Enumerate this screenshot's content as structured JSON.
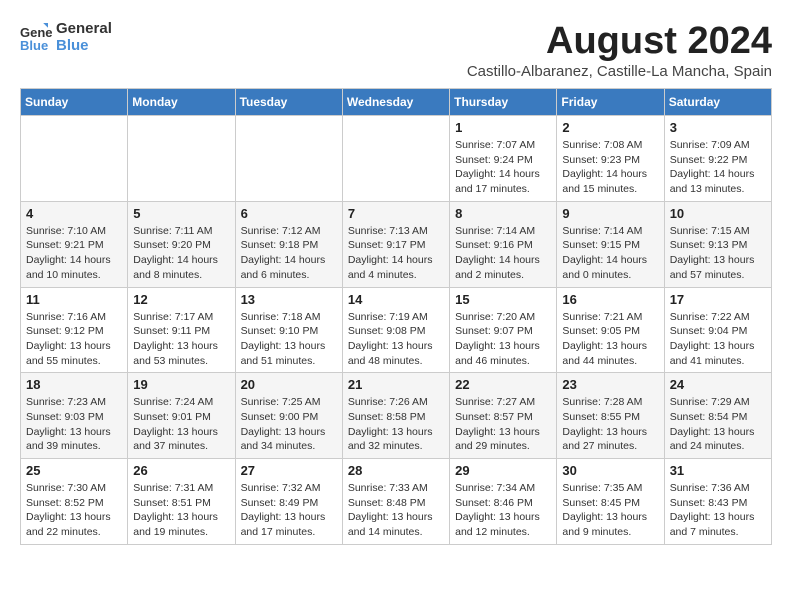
{
  "logo": {
    "line1": "General",
    "line2": "Blue"
  },
  "title": "August 2024",
  "location": "Castillo-Albaranez, Castille-La Mancha, Spain",
  "days_header": [
    "Sunday",
    "Monday",
    "Tuesday",
    "Wednesday",
    "Thursday",
    "Friday",
    "Saturday"
  ],
  "weeks": [
    [
      {
        "day": "",
        "info": ""
      },
      {
        "day": "",
        "info": ""
      },
      {
        "day": "",
        "info": ""
      },
      {
        "day": "",
        "info": ""
      },
      {
        "day": "1",
        "info": "Sunrise: 7:07 AM\nSunset: 9:24 PM\nDaylight: 14 hours\nand 17 minutes."
      },
      {
        "day": "2",
        "info": "Sunrise: 7:08 AM\nSunset: 9:23 PM\nDaylight: 14 hours\nand 15 minutes."
      },
      {
        "day": "3",
        "info": "Sunrise: 7:09 AM\nSunset: 9:22 PM\nDaylight: 14 hours\nand 13 minutes."
      }
    ],
    [
      {
        "day": "4",
        "info": "Sunrise: 7:10 AM\nSunset: 9:21 PM\nDaylight: 14 hours\nand 10 minutes."
      },
      {
        "day": "5",
        "info": "Sunrise: 7:11 AM\nSunset: 9:20 PM\nDaylight: 14 hours\nand 8 minutes."
      },
      {
        "day": "6",
        "info": "Sunrise: 7:12 AM\nSunset: 9:18 PM\nDaylight: 14 hours\nand 6 minutes."
      },
      {
        "day": "7",
        "info": "Sunrise: 7:13 AM\nSunset: 9:17 PM\nDaylight: 14 hours\nand 4 minutes."
      },
      {
        "day": "8",
        "info": "Sunrise: 7:14 AM\nSunset: 9:16 PM\nDaylight: 14 hours\nand 2 minutes."
      },
      {
        "day": "9",
        "info": "Sunrise: 7:14 AM\nSunset: 9:15 PM\nDaylight: 14 hours\nand 0 minutes."
      },
      {
        "day": "10",
        "info": "Sunrise: 7:15 AM\nSunset: 9:13 PM\nDaylight: 13 hours\nand 57 minutes."
      }
    ],
    [
      {
        "day": "11",
        "info": "Sunrise: 7:16 AM\nSunset: 9:12 PM\nDaylight: 13 hours\nand 55 minutes."
      },
      {
        "day": "12",
        "info": "Sunrise: 7:17 AM\nSunset: 9:11 PM\nDaylight: 13 hours\nand 53 minutes."
      },
      {
        "day": "13",
        "info": "Sunrise: 7:18 AM\nSunset: 9:10 PM\nDaylight: 13 hours\nand 51 minutes."
      },
      {
        "day": "14",
        "info": "Sunrise: 7:19 AM\nSunset: 9:08 PM\nDaylight: 13 hours\nand 48 minutes."
      },
      {
        "day": "15",
        "info": "Sunrise: 7:20 AM\nSunset: 9:07 PM\nDaylight: 13 hours\nand 46 minutes."
      },
      {
        "day": "16",
        "info": "Sunrise: 7:21 AM\nSunset: 9:05 PM\nDaylight: 13 hours\nand 44 minutes."
      },
      {
        "day": "17",
        "info": "Sunrise: 7:22 AM\nSunset: 9:04 PM\nDaylight: 13 hours\nand 41 minutes."
      }
    ],
    [
      {
        "day": "18",
        "info": "Sunrise: 7:23 AM\nSunset: 9:03 PM\nDaylight: 13 hours\nand 39 minutes."
      },
      {
        "day": "19",
        "info": "Sunrise: 7:24 AM\nSunset: 9:01 PM\nDaylight: 13 hours\nand 37 minutes."
      },
      {
        "day": "20",
        "info": "Sunrise: 7:25 AM\nSunset: 9:00 PM\nDaylight: 13 hours\nand 34 minutes."
      },
      {
        "day": "21",
        "info": "Sunrise: 7:26 AM\nSunset: 8:58 PM\nDaylight: 13 hours\nand 32 minutes."
      },
      {
        "day": "22",
        "info": "Sunrise: 7:27 AM\nSunset: 8:57 PM\nDaylight: 13 hours\nand 29 minutes."
      },
      {
        "day": "23",
        "info": "Sunrise: 7:28 AM\nSunset: 8:55 PM\nDaylight: 13 hours\nand 27 minutes."
      },
      {
        "day": "24",
        "info": "Sunrise: 7:29 AM\nSunset: 8:54 PM\nDaylight: 13 hours\nand 24 minutes."
      }
    ],
    [
      {
        "day": "25",
        "info": "Sunrise: 7:30 AM\nSunset: 8:52 PM\nDaylight: 13 hours\nand 22 minutes."
      },
      {
        "day": "26",
        "info": "Sunrise: 7:31 AM\nSunset: 8:51 PM\nDaylight: 13 hours\nand 19 minutes."
      },
      {
        "day": "27",
        "info": "Sunrise: 7:32 AM\nSunset: 8:49 PM\nDaylight: 13 hours\nand 17 minutes."
      },
      {
        "day": "28",
        "info": "Sunrise: 7:33 AM\nSunset: 8:48 PM\nDaylight: 13 hours\nand 14 minutes."
      },
      {
        "day": "29",
        "info": "Sunrise: 7:34 AM\nSunset: 8:46 PM\nDaylight: 13 hours\nand 12 minutes."
      },
      {
        "day": "30",
        "info": "Sunrise: 7:35 AM\nSunset: 8:45 PM\nDaylight: 13 hours\nand 9 minutes."
      },
      {
        "day": "31",
        "info": "Sunrise: 7:36 AM\nSunset: 8:43 PM\nDaylight: 13 hours\nand 7 minutes."
      }
    ]
  ]
}
